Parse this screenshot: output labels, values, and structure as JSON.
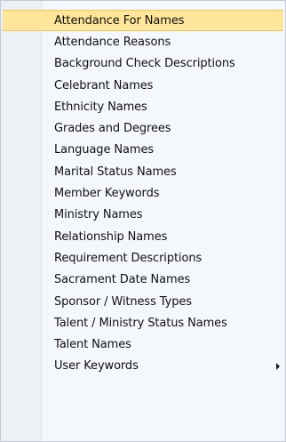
{
  "menu": {
    "items": [
      {
        "label": "Attendance For Names"
      },
      {
        "label": "Attendance Reasons"
      },
      {
        "label": "Background Check Descriptions"
      },
      {
        "label": "Celebrant Names"
      },
      {
        "label": "Ethnicity Names"
      },
      {
        "label": "Grades and Degrees"
      },
      {
        "label": "Language Names"
      },
      {
        "label": "Marital Status Names"
      },
      {
        "label": "Member Keywords"
      },
      {
        "label": "Ministry Names"
      },
      {
        "label": "Relationship Names"
      },
      {
        "label": "Requirement Descriptions"
      },
      {
        "label": "Sacrament Date Names"
      },
      {
        "label": "Sponsor / Witness Types"
      },
      {
        "label": "Talent / Ministry Status Names"
      },
      {
        "label": "Talent Names"
      },
      {
        "label": "User Keywords"
      }
    ],
    "selected_label": "Attendance For Names",
    "submenu_icon": "submenu-arrow-icon",
    "colors": {
      "selected_background": "#ffe69a",
      "selected_border": "#f1c550",
      "menu_background": "#f4f7fb",
      "gutter_background": "#edf0f4",
      "text": "#111111"
    }
  }
}
